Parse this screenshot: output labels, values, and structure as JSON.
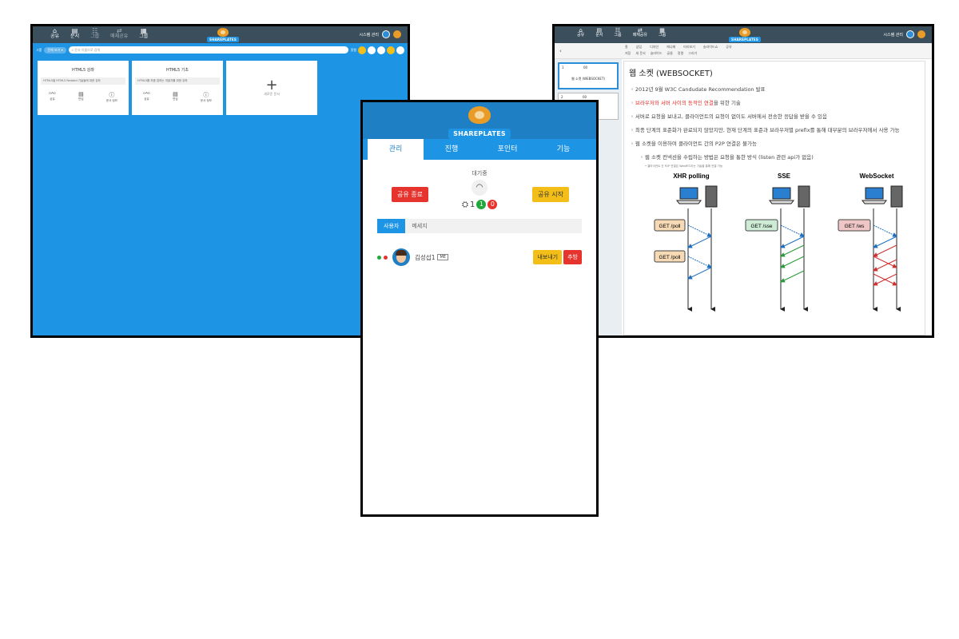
{
  "left": {
    "nav": [
      {
        "icon": "home-icon",
        "label": "공유",
        "glyph": "⌂"
      },
      {
        "icon": "doc-icon",
        "label": "문서",
        "glyph": "▤"
      },
      {
        "icon": "group-icon",
        "label": "그룹",
        "glyph": "☷"
      },
      {
        "icon": "share-icon",
        "label": "매체공유",
        "glyph": "⇄"
      },
      {
        "icon": "grid-icon",
        "label": "그룹",
        "glyph": "▦"
      }
    ],
    "logo_text": "SHAREPLATES",
    "user_name": "시스템 관리",
    "group_label": "그룹",
    "group_select": "전체 보기",
    "search_placeholder": "문서 이름으로 검색",
    "sort_label": "정렬",
    "cards": [
      {
        "title": "HTML5 강좌",
        "desc": "HTML5을 HTML5 Related 기술들에 대한 강좌",
        "actions": [
          {
            "glyph": "ᵒᴬᵒ",
            "label": "공유"
          },
          {
            "glyph": "▤",
            "label": "편집"
          },
          {
            "glyph": "ⓘ",
            "label": "문서 정보"
          }
        ]
      },
      {
        "title": "HTML5 기초",
        "desc": "HTML5를 처음 접하는 개발자를 위한 강좌",
        "actions": [
          {
            "glyph": "ᵒᴬᵒ",
            "label": "공유"
          },
          {
            "glyph": "▤",
            "label": "편집"
          },
          {
            "glyph": "ⓘ",
            "label": "문서 정보"
          }
        ]
      }
    ],
    "new_card_label": "새로운 문서"
  },
  "right": {
    "nav": [
      {
        "icon": "home-icon",
        "label": "공유",
        "glyph": "⌂"
      },
      {
        "icon": "doc-icon",
        "label": "문서",
        "glyph": "▤"
      },
      {
        "icon": "group-icon",
        "label": "그룹",
        "glyph": "☷"
      },
      {
        "icon": "share-icon",
        "label": "매체공유",
        "glyph": "⇄"
      },
      {
        "icon": "grid-icon",
        "label": "그룹",
        "glyph": "▦"
      }
    ],
    "logo_text": "SHAREPLATES",
    "user_name": "시스템 관리",
    "toolbar_tabs": [
      "홈",
      "삽입",
      "디자인",
      "애니메",
      "미리보기",
      "슬라이드쇼",
      "공유"
    ],
    "toolbar_tools": [
      "저장",
      "새 문서",
      "슬라이드",
      "글꼴",
      "정렬",
      "그리기"
    ],
    "thumbs": [
      {
        "num": "1",
        "mark": "00",
        "title": "웹 소켓 (WEBSOCKET)"
      },
      {
        "num": "2",
        "mark": "00",
        "title": ""
      }
    ],
    "slide": {
      "title": "웹 소켓 (WEBSOCKET)",
      "b1": "2012년 9월 W3C Candudate Recommendation 발표",
      "b2_red": "브라우저와 서버 사이의 동적인 연결",
      "b2_tail": "을 위한 기술",
      "b3": "서버로 요청을 보내고, 클라이언트의 요청이 없이도 서버에서 전송한 응답을 받을 수 있음",
      "b4": "최종 단계의 표준화가 완료되지 않았지만, 현재 단계의 표준과 브라우저별 prefix를 통해 대부분의 브라우저에서 사용 가능",
      "b5": "웹 소켓을 이용하여 클라이언트 간의 P2P 연결은 불가능",
      "b6": "웹 소켓 컨넥션을 수립하는 방법은 요청을 통한 방식 (listen 관련 api가 없음)",
      "b7": "클라이언트 간 P2P 연결은 WebRTC라는 기술을 통해 연결 가능",
      "diagram": {
        "col1": "XHR polling",
        "col2": "SSE",
        "col3": "WebSocket",
        "get_poll": "GET /poll",
        "get_sse": "GET /sse",
        "get_ws": "GET /ws"
      }
    }
  },
  "mid": {
    "logo_text": "SHAREPLATES",
    "tabs": [
      "관리",
      "진행",
      "포인터",
      "기능"
    ],
    "status": "대기중",
    "end_button": "공유 종료",
    "start_button": "공유 시작",
    "count_total": "1",
    "count_green": "1",
    "count_red": "0",
    "subtabs": [
      "사용자",
      "메세지"
    ],
    "user_name": "김성섭1",
    "me_badge": "ME",
    "export_button": "내보내기",
    "kick_button": "추방",
    "colors": {
      "blue": "#1e94e4",
      "red": "#e7332e",
      "yellow": "#f3be17",
      "green": "#22a83a"
    }
  }
}
